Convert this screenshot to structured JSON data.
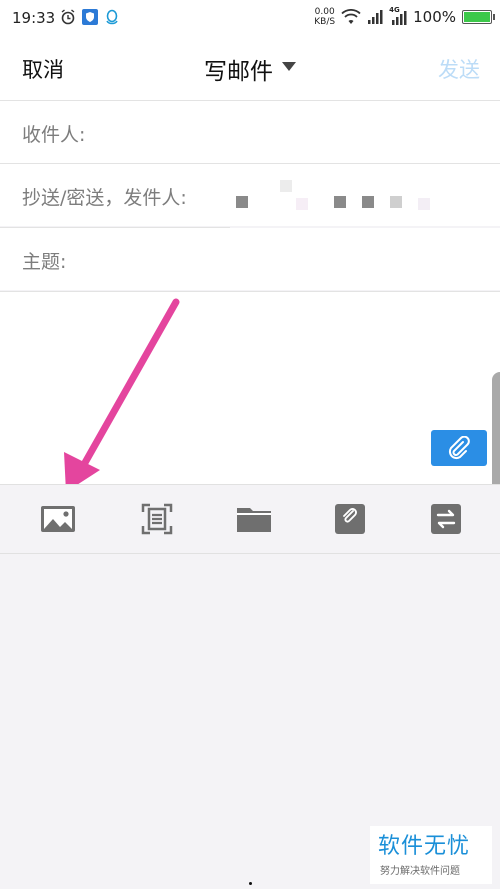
{
  "status_bar": {
    "time": "19:33",
    "net_speed_value": "0.00",
    "net_speed_unit": "KB/S",
    "network_tag": "4G",
    "battery": "100%"
  },
  "header": {
    "cancel": "取消",
    "title": "写邮件",
    "send": "发送"
  },
  "fields": {
    "to_label": "收件人:",
    "cc_label": "抄送/密送，发件人:",
    "subject_label": "主题:"
  },
  "toolbar": {
    "items": [
      "image-icon",
      "scan-document-icon",
      "folder-icon",
      "note-attachment-icon",
      "transfer-icon"
    ]
  },
  "watermark": {
    "title": "软件无忧",
    "subtitle": "努力解决软件问题"
  },
  "colors": {
    "accent": "#2b8ee5",
    "send_disabled": "#bcdcf7",
    "arrow": "#e4459e"
  }
}
